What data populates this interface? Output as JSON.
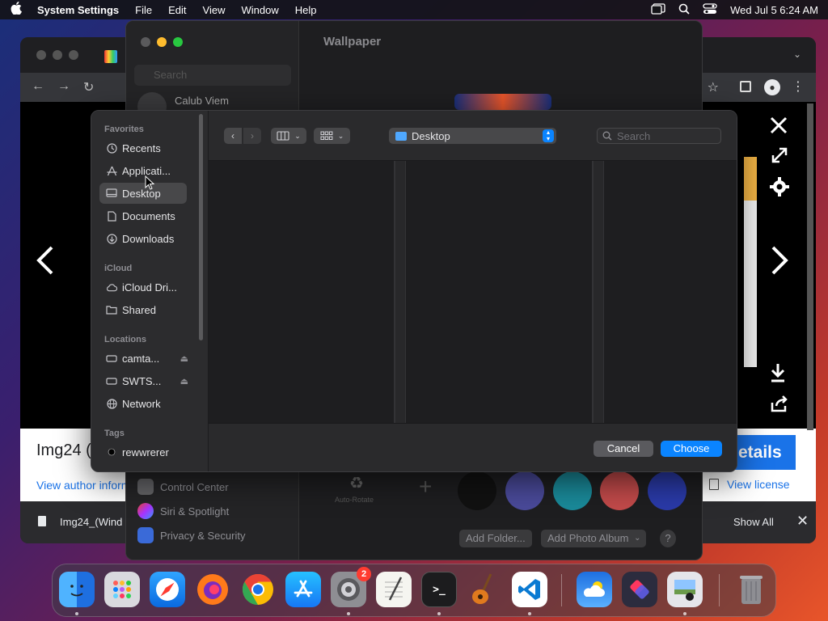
{
  "menubar": {
    "app": "System Settings",
    "items": [
      "File",
      "Edit",
      "View",
      "Window",
      "Help"
    ],
    "datetime": "Wed Jul 5  6:24 AM"
  },
  "browser": {
    "caption_title": "Img24 (",
    "author_link": "View author inform",
    "details_button": "etails",
    "license_link": "View license",
    "download_file": "Img24_(Wind",
    "show_all": "Show All"
  },
  "settings": {
    "title": "Wallpaper",
    "search_placeholder": "Search",
    "user": "Calub Viem",
    "sidebar_items": [
      {
        "label": "Control Center",
        "color": "#636366"
      },
      {
        "label": "Siri & Spotlight",
        "color": "#7a3ab8"
      },
      {
        "label": "Privacy & Security",
        "color": "#3a6ad8"
      }
    ],
    "auto_rotate": "Auto-Rotate",
    "add_folder": "Add Folder...",
    "add_album": "Add Photo Album",
    "help": "?",
    "swatches": [
      "#111111",
      "#4a4a9a",
      "#1a8a9a",
      "#c24a4a",
      "#2a3aa8"
    ]
  },
  "dialog": {
    "sections": {
      "favorites": "Favorites",
      "icloud": "iCloud",
      "locations": "Locations",
      "tags": "Tags"
    },
    "favorites": [
      {
        "label": "Recents",
        "icon": "clock-icon"
      },
      {
        "label": "Applicati...",
        "icon": "applications-icon"
      },
      {
        "label": "Desktop",
        "icon": "desktop-icon"
      },
      {
        "label": "Documents",
        "icon": "document-icon"
      },
      {
        "label": "Downloads",
        "icon": "download-icon"
      }
    ],
    "icloud": [
      {
        "label": "iCloud Dri...",
        "icon": "cloud-icon"
      },
      {
        "label": "Shared",
        "icon": "shared-folder-icon"
      }
    ],
    "locations": [
      {
        "label": "camta...",
        "icon": "drive-icon"
      },
      {
        "label": "SWTS...",
        "icon": "drive-icon"
      },
      {
        "label": "Network",
        "icon": "globe-icon"
      }
    ],
    "tags": [
      {
        "label": "rewwrerer",
        "color": "#000000"
      }
    ],
    "path_location": "Desktop",
    "search_placeholder": "Search",
    "cancel": "Cancel",
    "choose": "Choose"
  },
  "dock": {
    "settings_badge": "2"
  }
}
